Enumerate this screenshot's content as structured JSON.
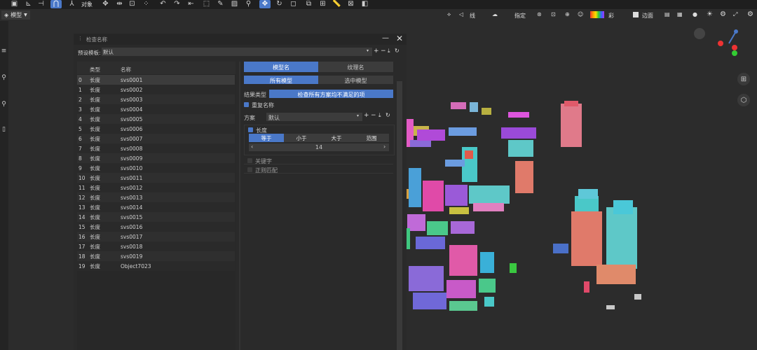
{
  "toolbar": {
    "object_label": "对象",
    "mode_label": "模型"
  },
  "viewport": {
    "line_label": "线",
    "specify_label": "指定",
    "color_label": "彩",
    "edge_label": "边面"
  },
  "panel": {
    "title": "检查名称",
    "preset_label": "预设模板:",
    "preset_value": "默认",
    "table_headers": {
      "type": "类型",
      "name": "名称"
    },
    "rows": [
      {
        "index": "0",
        "type": "长度",
        "name": "svs0001"
      },
      {
        "index": "1",
        "type": "长度",
        "name": "svs0002"
      },
      {
        "index": "2",
        "type": "长度",
        "name": "svs0003"
      },
      {
        "index": "3",
        "type": "长度",
        "name": "svs0004"
      },
      {
        "index": "4",
        "type": "长度",
        "name": "svs0005"
      },
      {
        "index": "5",
        "type": "长度",
        "name": "svs0006"
      },
      {
        "index": "6",
        "type": "长度",
        "name": "svs0007"
      },
      {
        "index": "7",
        "type": "长度",
        "name": "svs0008"
      },
      {
        "index": "8",
        "type": "长度",
        "name": "svs0009"
      },
      {
        "index": "9",
        "type": "长度",
        "name": "svs0010"
      },
      {
        "index": "10",
        "type": "长度",
        "name": "svs0011"
      },
      {
        "index": "11",
        "type": "长度",
        "name": "svs0012"
      },
      {
        "index": "12",
        "type": "长度",
        "name": "svs0013"
      },
      {
        "index": "13",
        "type": "长度",
        "name": "svs0014"
      },
      {
        "index": "14",
        "type": "长度",
        "name": "svs0015"
      },
      {
        "index": "15",
        "type": "长度",
        "name": "svs0016"
      },
      {
        "index": "16",
        "type": "长度",
        "name": "svs0017"
      },
      {
        "index": "17",
        "type": "长度",
        "name": "svs0018"
      },
      {
        "index": "18",
        "type": "长度",
        "name": "svs0019"
      },
      {
        "index": "19",
        "type": "长度",
        "name": "Object7023"
      }
    ],
    "tabs": {
      "model_name": "模型名",
      "texture_name": "纹理名"
    },
    "scope": {
      "all_models": "所有模型",
      "selected_models": "选中模型"
    },
    "result_type_label": "结果类型",
    "result_type_value": "检查所有方案均不满足的项",
    "duplicate_name_label": "重复名称",
    "scheme_label": "方案",
    "scheme_value": "默认",
    "length_label": "长度",
    "compare_options": [
      "等于",
      "小于",
      "大于",
      "范围"
    ],
    "length_value": "14",
    "keyword_label": "关键字",
    "regex_label": "正则匹配"
  },
  "colors": {
    "accent": "#4a78c8",
    "panel_bg": "#2a2a2a",
    "viewport_bg": "#2c2c2c"
  }
}
